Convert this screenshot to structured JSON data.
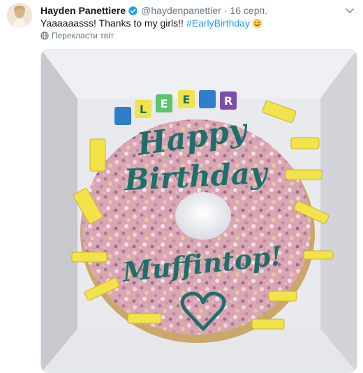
{
  "tweet": {
    "author_name": "Hayden Panettiere",
    "author_handle": "@haydenpanettier",
    "separator": "·",
    "date": "16 серп.",
    "text": "Yaaaaaasss! Thanks to my girls!!",
    "hashtag": "#EarlyBirthday",
    "translate_label": "Перекласти твіт"
  },
  "image": {
    "line1": "Happy",
    "line2": "Birthday",
    "line3": "Muffintop!",
    "candle_letters": [
      "L",
      "E",
      "E",
      "R"
    ]
  },
  "colors": {
    "link": "#1da1f2",
    "muted": "#657786",
    "icing": "#1e6f6a",
    "candle": "#f2e34a"
  },
  "icons": [
    "verified-badge-icon",
    "chevron-down-icon",
    "smile-emoji-icon",
    "globe-icon"
  ]
}
